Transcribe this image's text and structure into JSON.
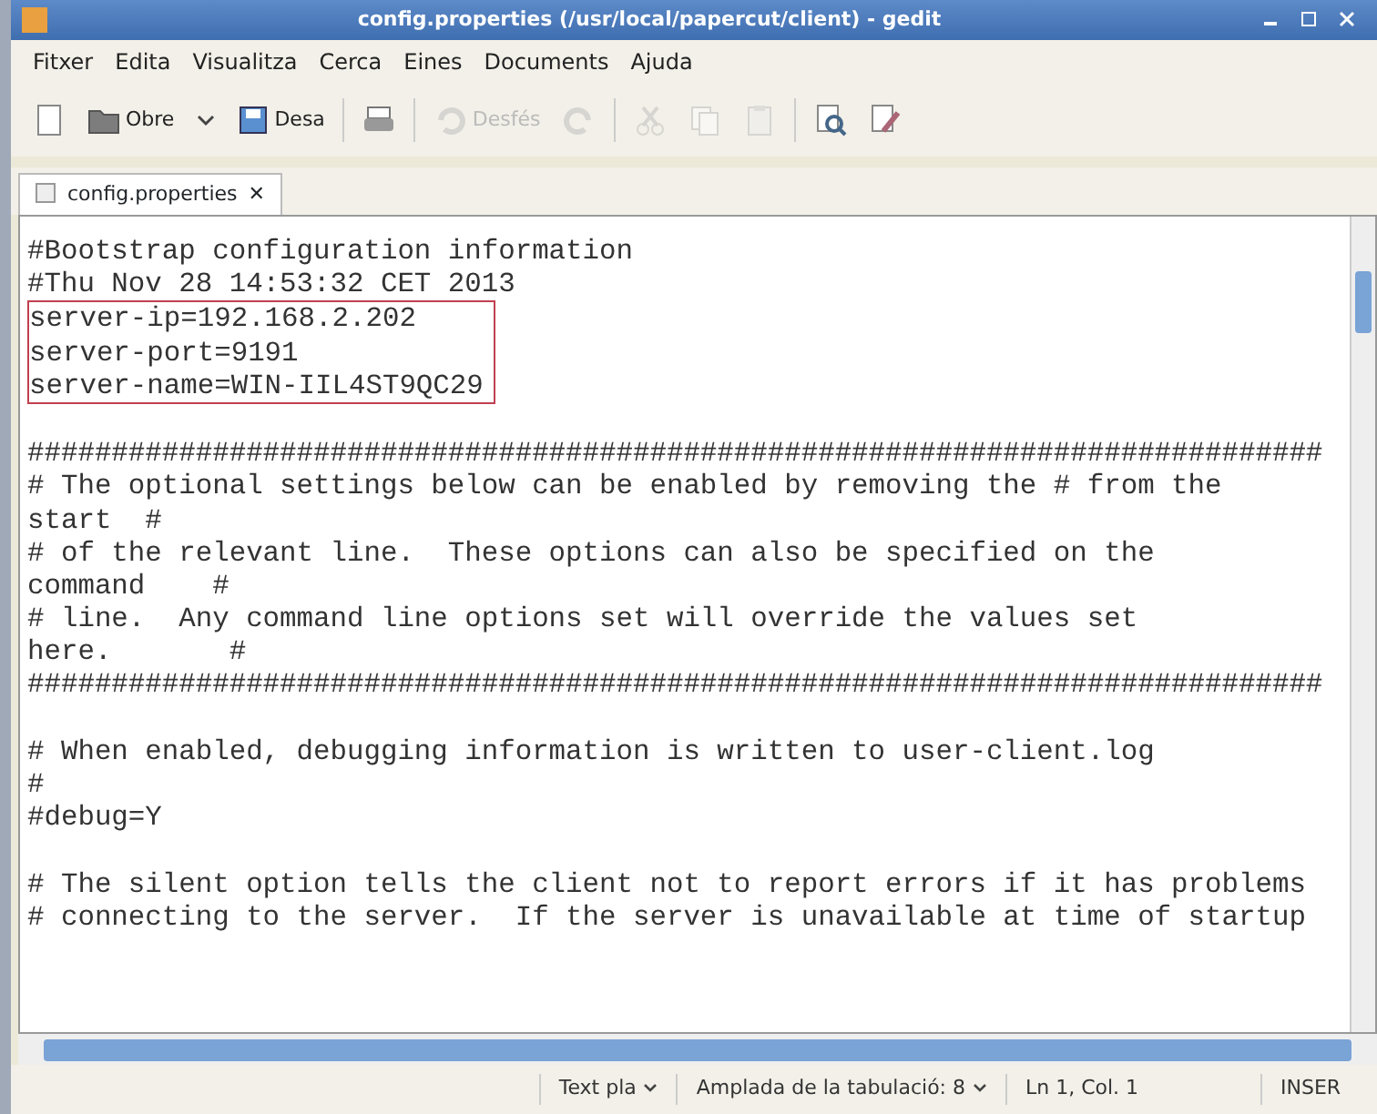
{
  "window": {
    "title": "config.properties (/usr/local/papercut/client) - gedit"
  },
  "menu": [
    "Fitxer",
    "Edita",
    "Visualitza",
    "Cerca",
    "Eines",
    "Documents",
    "Ajuda"
  ],
  "toolbar": [
    {
      "kind": "new",
      "disabled": false
    },
    {
      "kind": "open",
      "label": "Obre",
      "disabled": false
    },
    {
      "kind": "save",
      "label": "Desa",
      "disabled": false
    },
    {
      "kind": "sep"
    },
    {
      "kind": "print",
      "disabled": false
    },
    {
      "kind": "sep"
    },
    {
      "kind": "undo",
      "label": "Desfés",
      "disabled": true
    },
    {
      "kind": "redo",
      "disabled": true
    },
    {
      "kind": "sep"
    },
    {
      "kind": "cut",
      "disabled": true
    },
    {
      "kind": "copy",
      "disabled": true
    },
    {
      "kind": "paste",
      "disabled": true
    },
    {
      "kind": "sep"
    },
    {
      "kind": "find",
      "disabled": false
    },
    {
      "kind": "replace",
      "disabled": false
    }
  ],
  "tabs": [
    {
      "label": "config.properties",
      "close": "✕",
      "selected": true
    }
  ],
  "lines": [
    {
      "kind": "text",
      "text": "#Bootstrap configuration information"
    },
    {
      "kind": "text",
      "text": "#Thu Nov 28 14:53:32 CET 2013"
    },
    {
      "kind": "boxed",
      "lines": [
        "server-ip=192.168.2.202",
        "server-port=9191",
        "server-name=WIN-IIL4ST9QC29"
      ]
    },
    {
      "kind": "blank"
    },
    {
      "kind": "text",
      "text": "#############################################################################"
    },
    {
      "kind": "text",
      "text": "# The optional settings below can be enabled by removing the # from the"
    },
    {
      "kind": "text",
      "text": "start  #"
    },
    {
      "kind": "text",
      "text": "# of the relevant line.  These options can also be specified on the"
    },
    {
      "kind": "text",
      "text": "command    #"
    },
    {
      "kind": "text",
      "text": "# line.  Any command line options set will override the values set"
    },
    {
      "kind": "text",
      "text": "here.       #"
    },
    {
      "kind": "text",
      "text": "#############################################################################"
    },
    {
      "kind": "blank"
    },
    {
      "kind": "text",
      "text": "# When enabled, debugging information is written to user-client.log"
    },
    {
      "kind": "text",
      "text": "#"
    },
    {
      "kind": "text",
      "text": "#debug=Y"
    },
    {
      "kind": "blank"
    },
    {
      "kind": "text",
      "text": "# The silent option tells the client not to report errors if it has problems"
    },
    {
      "kind": "text",
      "text": "# connecting to the server.  If the server is unavailable at time of startup"
    }
  ],
  "status_bar": {
    "language": "Text pla",
    "tab_width": "Amplada de la tabulació: 8",
    "position": "Ln 1, Col. 1",
    "mode": "INSER"
  }
}
